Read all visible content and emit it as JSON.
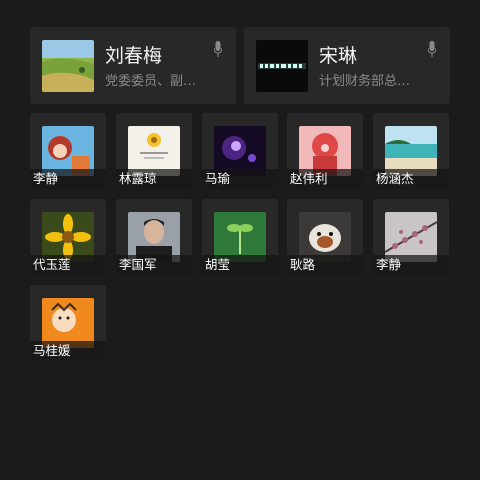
{
  "favorites": [
    {
      "name": "刘春梅",
      "subtitle": "党委委员、副…",
      "thumb_icon": "grassland-photo",
      "mic_icon": "microphone-icon"
    },
    {
      "name": "宋琳",
      "subtitle": "计划财务部总…",
      "thumb_icon": "dark-banner-photo",
      "mic_icon": "microphone-icon"
    }
  ],
  "contacts": [
    {
      "name": "李静",
      "thumb_icon": "cartoon-girl-photo"
    },
    {
      "name": "林露琼",
      "thumb_icon": "flower-card-photo"
    },
    {
      "name": "马瑜",
      "thumb_icon": "purple-sparkle-photo"
    },
    {
      "name": "赵伟利",
      "thumb_icon": "cartoon-pig-photo"
    },
    {
      "name": "杨涵杰",
      "thumb_icon": "beach-photo"
    },
    {
      "name": "代玉莲",
      "thumb_icon": "yellow-flower-photo"
    },
    {
      "name": "李国军",
      "thumb_icon": "man-portrait-photo"
    },
    {
      "name": "胡莹",
      "thumb_icon": "green-sprout-photo"
    },
    {
      "name": "耿路",
      "thumb_icon": "dog-photo"
    },
    {
      "name": "李静",
      "thumb_icon": "blossom-branch-photo"
    },
    {
      "name": "马桂媛",
      "thumb_icon": "cartoon-orange-face-photo"
    }
  ]
}
